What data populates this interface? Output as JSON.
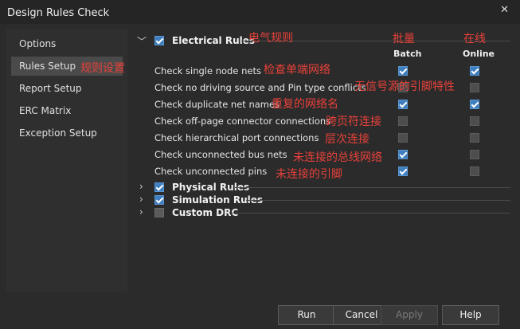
{
  "window": {
    "title": "Design Rules Check",
    "close_glyph": "✕"
  },
  "sidebar": {
    "items": [
      {
        "label": "Options"
      },
      {
        "label": "Rules Setup",
        "active": true
      },
      {
        "label": "Report Setup"
      },
      {
        "label": "ERC Matrix"
      },
      {
        "label": "Exception Setup"
      }
    ]
  },
  "electrical": {
    "title": "Electrical Rules",
    "checked": true,
    "col_batch": "Batch",
    "col_online": "Online",
    "rules": [
      {
        "label": "Check single node nets",
        "batch": true,
        "online": true
      },
      {
        "label": "Check no driving source and Pin type conflicts",
        "batch": false,
        "online": false
      },
      {
        "label": "Check duplicate net names",
        "batch": true,
        "online": true
      },
      {
        "label": "Check off-page connector connections",
        "batch": false,
        "online": false
      },
      {
        "label": "Check hierarchical port connections",
        "batch": false,
        "online": false
      },
      {
        "label": "Check unconnected bus nets",
        "batch": true,
        "online": false
      },
      {
        "label": "Check unconnected pins",
        "batch": true,
        "online": false
      }
    ]
  },
  "sections": [
    {
      "title": "Physical Rules",
      "checked": true
    },
    {
      "title": "Simulation Rules",
      "checked": true
    },
    {
      "title": "Custom DRC",
      "checked": false
    }
  ],
  "annotations": {
    "rules_setup": "规则设置",
    "electrical": "电气规则",
    "batch": "批量",
    "online": "在线",
    "rule_0": "检查单端网络",
    "rule_1": "无信号源的引脚特性",
    "rule_2": "重复的网络名",
    "rule_3": "跨页符连接",
    "rule_4": "层次连接",
    "rule_5": "未连接的总线网络",
    "rule_6": "未连接的引脚"
  },
  "buttons": {
    "run": "Run",
    "cancel": "Cancel",
    "apply": "Apply",
    "help": "Help"
  },
  "colors": {
    "accent": "#3f7fbf",
    "annotation": "#e8413a"
  }
}
